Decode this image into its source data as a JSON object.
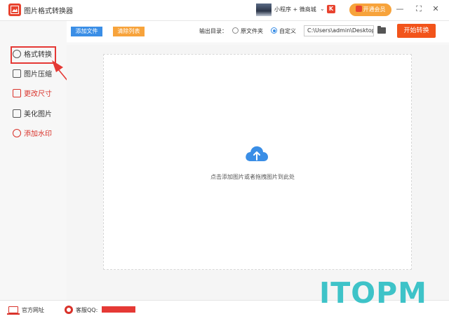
{
  "window": {
    "title": "图片格式转换器"
  },
  "topbar": {
    "mini_link": "小程序 + 微商城",
    "vip_label": "开通会员",
    "controls": [
      "—",
      "⛶",
      "✕"
    ]
  },
  "sidebar": {
    "items": [
      {
        "label": "格式转换",
        "icon": "format-convert-icon"
      },
      {
        "label": "图片压缩",
        "icon": "compress-icon"
      },
      {
        "label": "更改尺寸",
        "icon": "resize-icon"
      },
      {
        "label": "美化图片",
        "icon": "beautify-icon"
      },
      {
        "label": "添加水印",
        "icon": "watermark-icon"
      }
    ]
  },
  "toolbar": {
    "add_file": "添加文件",
    "clear_list": "清除列表",
    "output_label": "输出目录：",
    "option_original": "原文件夹",
    "option_custom": "自定义",
    "selected_option": "自定义",
    "path_value": "C:\\Users\\admin\\Desktop",
    "start": "开始转换"
  },
  "drop_area": {
    "hint": "点击添加图片或者拖拽图片到此处"
  },
  "footer": {
    "website": "官方网址",
    "support_qq": "客服QQ:"
  },
  "watermark": "ITOPM",
  "colors": {
    "accent_blue": "#3a8ee6",
    "accent_orange": "#f7a33b",
    "start_red": "#f2541b",
    "brand_red": "#e8432f",
    "watermark_teal": "#3ec3c8"
  }
}
